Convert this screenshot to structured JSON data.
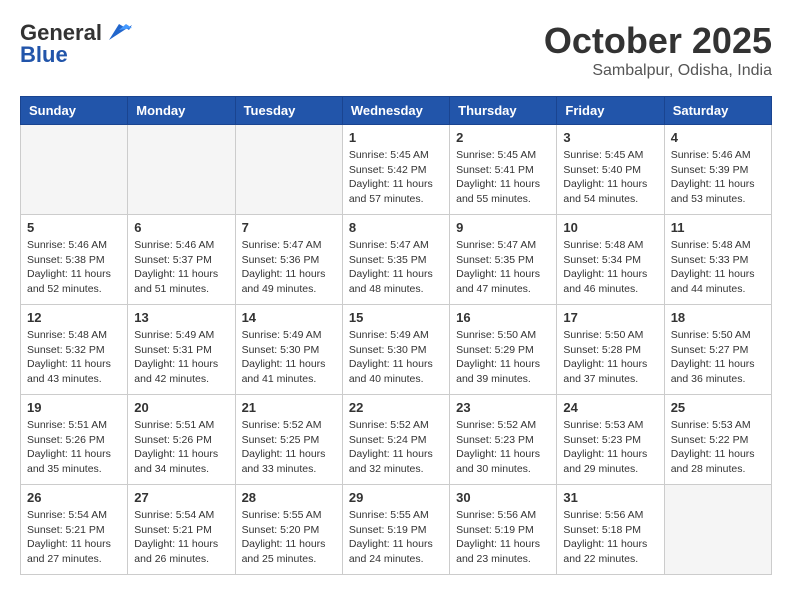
{
  "logo": {
    "line1": "General",
    "line2": "Blue"
  },
  "title": "October 2025",
  "location": "Sambalpur, Odisha, India",
  "weekdays": [
    "Sunday",
    "Monday",
    "Tuesday",
    "Wednesday",
    "Thursday",
    "Friday",
    "Saturday"
  ],
  "weeks": [
    [
      {
        "day": "",
        "sunrise": "",
        "sunset": "",
        "daylight": ""
      },
      {
        "day": "",
        "sunrise": "",
        "sunset": "",
        "daylight": ""
      },
      {
        "day": "",
        "sunrise": "",
        "sunset": "",
        "daylight": ""
      },
      {
        "day": "1",
        "sunrise": "Sunrise: 5:45 AM",
        "sunset": "Sunset: 5:42 PM",
        "daylight": "Daylight: 11 hours and 57 minutes."
      },
      {
        "day": "2",
        "sunrise": "Sunrise: 5:45 AM",
        "sunset": "Sunset: 5:41 PM",
        "daylight": "Daylight: 11 hours and 55 minutes."
      },
      {
        "day": "3",
        "sunrise": "Sunrise: 5:45 AM",
        "sunset": "Sunset: 5:40 PM",
        "daylight": "Daylight: 11 hours and 54 minutes."
      },
      {
        "day": "4",
        "sunrise": "Sunrise: 5:46 AM",
        "sunset": "Sunset: 5:39 PM",
        "daylight": "Daylight: 11 hours and 53 minutes."
      }
    ],
    [
      {
        "day": "5",
        "sunrise": "Sunrise: 5:46 AM",
        "sunset": "Sunset: 5:38 PM",
        "daylight": "Daylight: 11 hours and 52 minutes."
      },
      {
        "day": "6",
        "sunrise": "Sunrise: 5:46 AM",
        "sunset": "Sunset: 5:37 PM",
        "daylight": "Daylight: 11 hours and 51 minutes."
      },
      {
        "day": "7",
        "sunrise": "Sunrise: 5:47 AM",
        "sunset": "Sunset: 5:36 PM",
        "daylight": "Daylight: 11 hours and 49 minutes."
      },
      {
        "day": "8",
        "sunrise": "Sunrise: 5:47 AM",
        "sunset": "Sunset: 5:35 PM",
        "daylight": "Daylight: 11 hours and 48 minutes."
      },
      {
        "day": "9",
        "sunrise": "Sunrise: 5:47 AM",
        "sunset": "Sunset: 5:35 PM",
        "daylight": "Daylight: 11 hours and 47 minutes."
      },
      {
        "day": "10",
        "sunrise": "Sunrise: 5:48 AM",
        "sunset": "Sunset: 5:34 PM",
        "daylight": "Daylight: 11 hours and 46 minutes."
      },
      {
        "day": "11",
        "sunrise": "Sunrise: 5:48 AM",
        "sunset": "Sunset: 5:33 PM",
        "daylight": "Daylight: 11 hours and 44 minutes."
      }
    ],
    [
      {
        "day": "12",
        "sunrise": "Sunrise: 5:48 AM",
        "sunset": "Sunset: 5:32 PM",
        "daylight": "Daylight: 11 hours and 43 minutes."
      },
      {
        "day": "13",
        "sunrise": "Sunrise: 5:49 AM",
        "sunset": "Sunset: 5:31 PM",
        "daylight": "Daylight: 11 hours and 42 minutes."
      },
      {
        "day": "14",
        "sunrise": "Sunrise: 5:49 AM",
        "sunset": "Sunset: 5:30 PM",
        "daylight": "Daylight: 11 hours and 41 minutes."
      },
      {
        "day": "15",
        "sunrise": "Sunrise: 5:49 AM",
        "sunset": "Sunset: 5:30 PM",
        "daylight": "Daylight: 11 hours and 40 minutes."
      },
      {
        "day": "16",
        "sunrise": "Sunrise: 5:50 AM",
        "sunset": "Sunset: 5:29 PM",
        "daylight": "Daylight: 11 hours and 39 minutes."
      },
      {
        "day": "17",
        "sunrise": "Sunrise: 5:50 AM",
        "sunset": "Sunset: 5:28 PM",
        "daylight": "Daylight: 11 hours and 37 minutes."
      },
      {
        "day": "18",
        "sunrise": "Sunrise: 5:50 AM",
        "sunset": "Sunset: 5:27 PM",
        "daylight": "Daylight: 11 hours and 36 minutes."
      }
    ],
    [
      {
        "day": "19",
        "sunrise": "Sunrise: 5:51 AM",
        "sunset": "Sunset: 5:26 PM",
        "daylight": "Daylight: 11 hours and 35 minutes."
      },
      {
        "day": "20",
        "sunrise": "Sunrise: 5:51 AM",
        "sunset": "Sunset: 5:26 PM",
        "daylight": "Daylight: 11 hours and 34 minutes."
      },
      {
        "day": "21",
        "sunrise": "Sunrise: 5:52 AM",
        "sunset": "Sunset: 5:25 PM",
        "daylight": "Daylight: 11 hours and 33 minutes."
      },
      {
        "day": "22",
        "sunrise": "Sunrise: 5:52 AM",
        "sunset": "Sunset: 5:24 PM",
        "daylight": "Daylight: 11 hours and 32 minutes."
      },
      {
        "day": "23",
        "sunrise": "Sunrise: 5:52 AM",
        "sunset": "Sunset: 5:23 PM",
        "daylight": "Daylight: 11 hours and 30 minutes."
      },
      {
        "day": "24",
        "sunrise": "Sunrise: 5:53 AM",
        "sunset": "Sunset: 5:23 PM",
        "daylight": "Daylight: 11 hours and 29 minutes."
      },
      {
        "day": "25",
        "sunrise": "Sunrise: 5:53 AM",
        "sunset": "Sunset: 5:22 PM",
        "daylight": "Daylight: 11 hours and 28 minutes."
      }
    ],
    [
      {
        "day": "26",
        "sunrise": "Sunrise: 5:54 AM",
        "sunset": "Sunset: 5:21 PM",
        "daylight": "Daylight: 11 hours and 27 minutes."
      },
      {
        "day": "27",
        "sunrise": "Sunrise: 5:54 AM",
        "sunset": "Sunset: 5:21 PM",
        "daylight": "Daylight: 11 hours and 26 minutes."
      },
      {
        "day": "28",
        "sunrise": "Sunrise: 5:55 AM",
        "sunset": "Sunset: 5:20 PM",
        "daylight": "Daylight: 11 hours and 25 minutes."
      },
      {
        "day": "29",
        "sunrise": "Sunrise: 5:55 AM",
        "sunset": "Sunset: 5:19 PM",
        "daylight": "Daylight: 11 hours and 24 minutes."
      },
      {
        "day": "30",
        "sunrise": "Sunrise: 5:56 AM",
        "sunset": "Sunset: 5:19 PM",
        "daylight": "Daylight: 11 hours and 23 minutes."
      },
      {
        "day": "31",
        "sunrise": "Sunrise: 5:56 AM",
        "sunset": "Sunset: 5:18 PM",
        "daylight": "Daylight: 11 hours and 22 minutes."
      },
      {
        "day": "",
        "sunrise": "",
        "sunset": "",
        "daylight": ""
      }
    ]
  ]
}
